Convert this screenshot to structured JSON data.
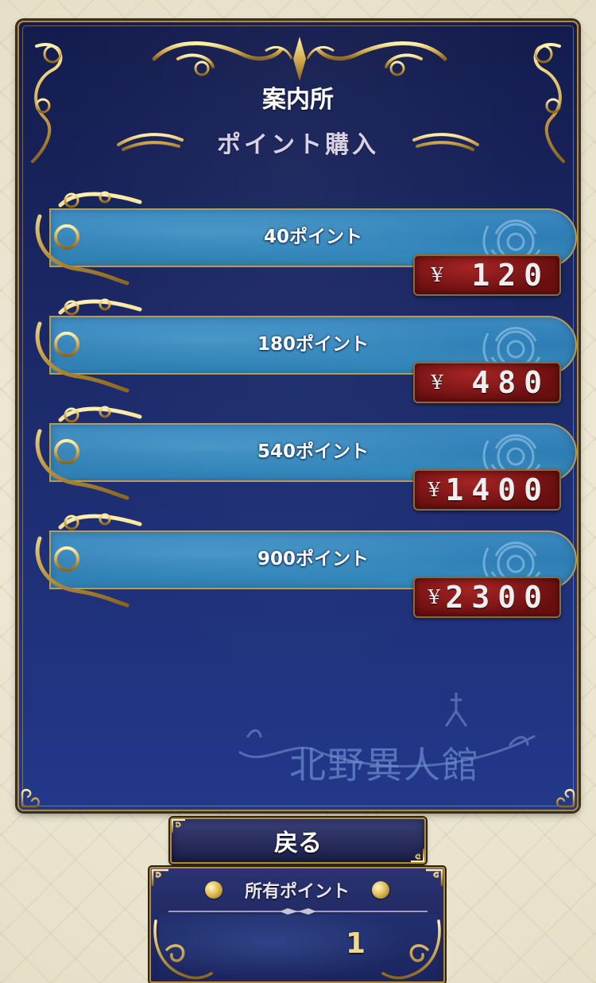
{
  "header": {
    "title": "案内所",
    "subtitle": "ポイント購入"
  },
  "items": [
    {
      "label": "40ポイント",
      "currency": "¥",
      "price": "120"
    },
    {
      "label": "180ポイント",
      "currency": "¥",
      "price": "480"
    },
    {
      "label": "540ポイント",
      "currency": "¥",
      "price": "1400"
    },
    {
      "label": "900ポイント",
      "currency": "¥",
      "price": "2300"
    }
  ],
  "logo": {
    "text": "北野異人館"
  },
  "back_button": {
    "label": "戻る"
  },
  "points": {
    "title": "所有ポイント",
    "value": "1"
  },
  "colors": {
    "panel": "#1c2a6a",
    "gold": "#c9a558",
    "item_bar": "#3186b8",
    "price_tag": "#7a1414",
    "points_value": "#f0d98a"
  }
}
